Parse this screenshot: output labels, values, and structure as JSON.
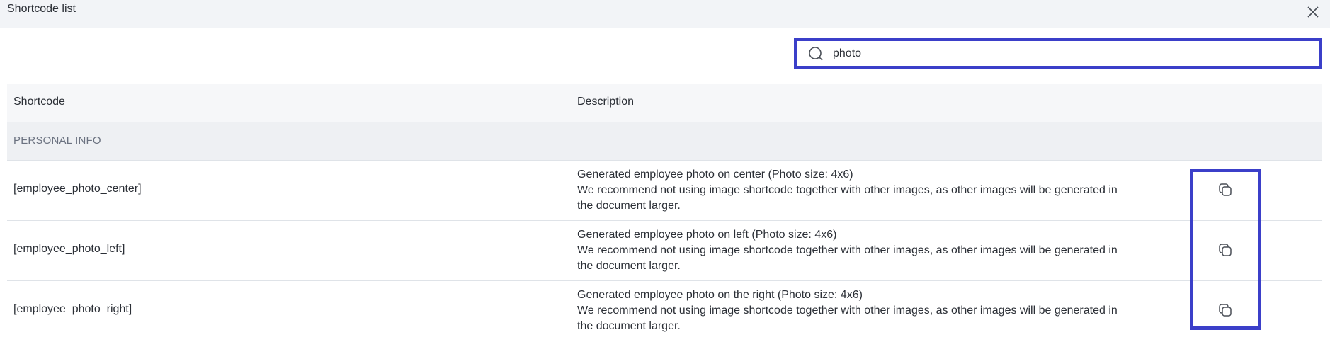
{
  "dialog": {
    "title": "Shortcode list",
    "close_icon": "close-icon"
  },
  "search": {
    "value": "photo",
    "icon": "search-icon"
  },
  "table": {
    "columns": [
      "Shortcode",
      "Description"
    ],
    "group": "PERSONAL INFO",
    "rows": [
      {
        "code": "[employee_photo_center]",
        "desc_line1": "Generated employee photo on center (Photo size: 4x6)",
        "desc_line2": "We recommend not using image shortcode together with other images, as other images will be generated in the document larger.",
        "action_icon": "copy-icon"
      },
      {
        "code": "[employee_photo_left]",
        "desc_line1": "Generated employee photo on left (Photo size: 4x6)",
        "desc_line2": "We recommend not using image shortcode together with other images, as other images will be generated in the document larger.",
        "action_icon": "copy-icon"
      },
      {
        "code": "[employee_photo_right]",
        "desc_line1": "Generated employee photo on the right (Photo size: 4x6)",
        "desc_line2": "We recommend not using image shortcode together with other images, as other images will be generated in the document larger.",
        "action_icon": "copy-icon"
      }
    ]
  },
  "colors": {
    "highlight": "#3b3fc9",
    "header_bg": "#f2f4f7",
    "group_bg": "#eef0f3"
  }
}
